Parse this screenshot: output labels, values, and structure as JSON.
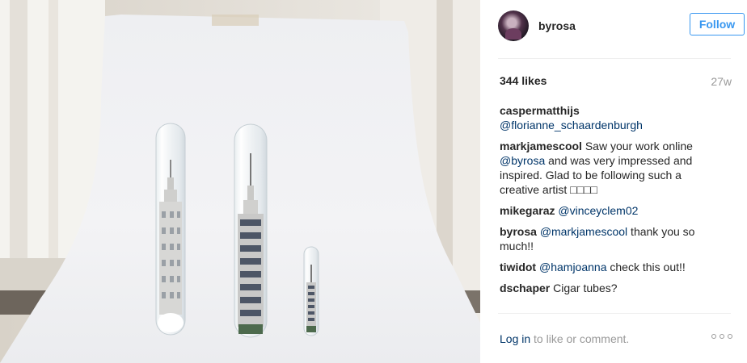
{
  "post": {
    "author": "byrosa",
    "follow_label": "Follow",
    "likes": "344 likes",
    "age": "27w",
    "comments": [
      {
        "author": "caspermatthijs",
        "parts": [
          {
            "type": "mention",
            "text": "@florianne_schaardenburgh"
          }
        ]
      },
      {
        "author": "markjamescool",
        "parts": [
          {
            "type": "text",
            "text": "Saw your work online "
          },
          {
            "type": "mention",
            "text": "@byrosa"
          },
          {
            "type": "text",
            "text": " and was very impressed and inspired. Glad to be following such a creative artist □□□□"
          }
        ]
      },
      {
        "author": "mikegaraz",
        "parts": [
          {
            "type": "mention",
            "text": "@vinceyclem02"
          }
        ]
      },
      {
        "author": "byrosa",
        "parts": [
          {
            "type": "mention",
            "text": "@markjamescool"
          },
          {
            "type": "text",
            "text": " thank you so much!!"
          }
        ]
      },
      {
        "author": "tiwidot",
        "parts": [
          {
            "type": "mention",
            "text": "@hamjoanna"
          },
          {
            "type": "text",
            "text": " check this out!!"
          }
        ]
      },
      {
        "author": "dschaper",
        "parts": [
          {
            "type": "text",
            "text": "Cigar tubes?"
          }
        ]
      }
    ],
    "footer": {
      "login_label": "Log in",
      "rest": " to like or comment."
    },
    "more_icon": "ellipsis-icon"
  },
  "photo": {
    "description_icon": "photo",
    "colors": {
      "backdrop": "#f1f1f3",
      "wall": "#e6e1da",
      "glass": "#dfe8ec",
      "building": "#cfcfcf"
    }
  }
}
